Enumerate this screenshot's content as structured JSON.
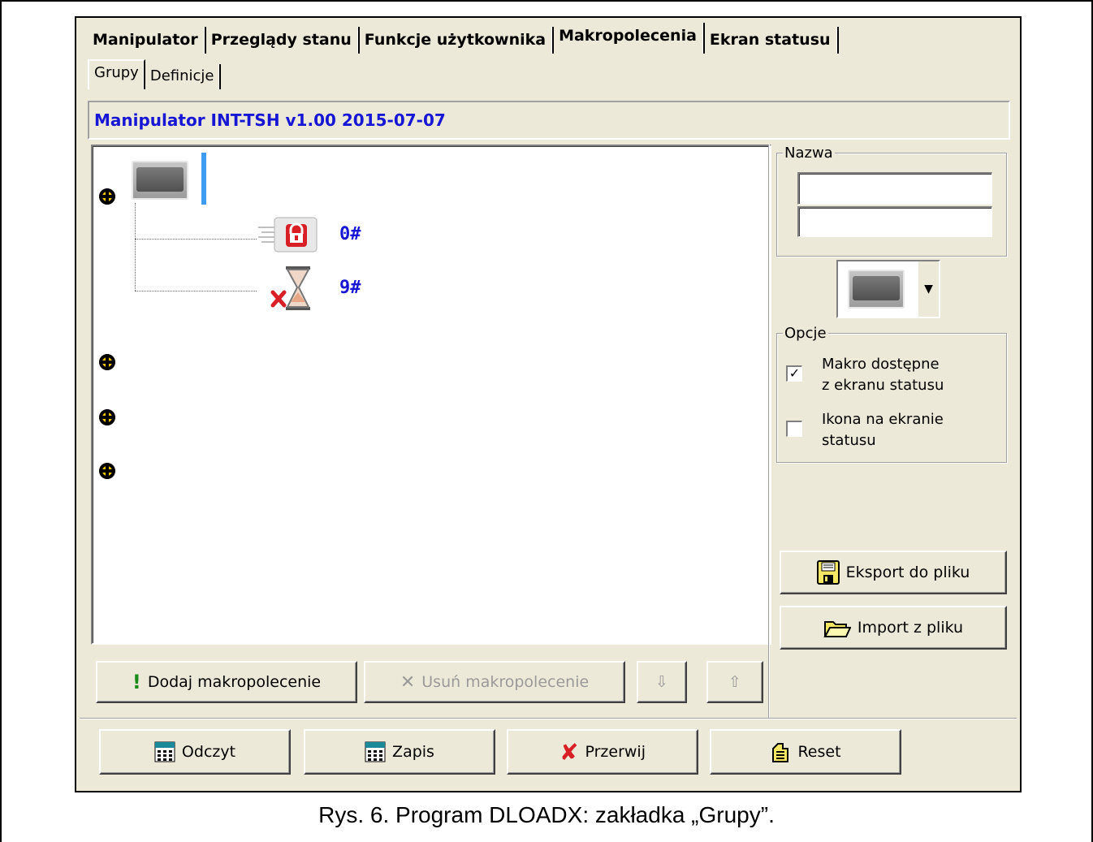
{
  "tabs": {
    "main": [
      "Manipulator",
      "Przeglądy stanu",
      "Funkcje użytkownika",
      "Makropolecenia",
      "Ekran statusu"
    ],
    "active_main": "Makropolecenia",
    "sub": [
      "Grupy",
      "Definicje"
    ],
    "active_sub": "Grupy"
  },
  "header": {
    "title": "Manipulator INT-TSH v1.00 2015-07-07"
  },
  "tree": {
    "children": [
      {
        "label": "0#",
        "icon": "lock-icon"
      },
      {
        "label": "9#",
        "icon": "hourglass-cancel-icon"
      }
    ]
  },
  "buttons": {
    "add_macro": "Dodaj makropolecenie",
    "remove_macro": "Usuń makropolecenie",
    "export": "Eksport do pliku",
    "import": "Import z pliku",
    "read": "Odczyt",
    "write": "Zapis",
    "interrupt": "Przerwij",
    "reset": "Reset"
  },
  "name_group": {
    "title": "Nazwa",
    "line1": "",
    "line2": ""
  },
  "options": {
    "title": "Opcje",
    "items": [
      {
        "label_line1": "Makro dostępne",
        "label_line2": "z ekranu statusu",
        "checked": true
      },
      {
        "label_line1": "Ikona na ekranie",
        "label_line2": "statusu",
        "checked": false
      }
    ]
  },
  "caption": "Rys. 6. Program DLOADX: zakładka „Grupy”.",
  "colors": {
    "accent_blue": "#1616d4",
    "bullet_yellow": "#f2c800",
    "cursor_blue": "#3d9bf0"
  }
}
